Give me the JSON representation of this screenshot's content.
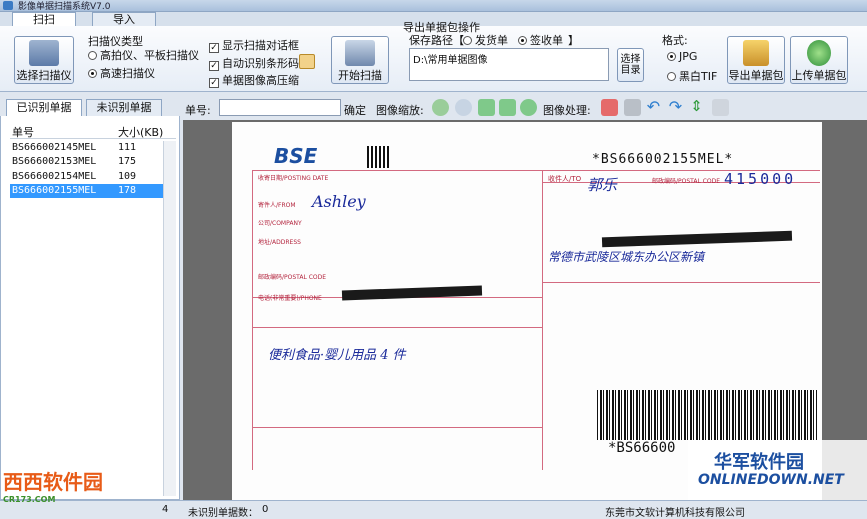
{
  "window": {
    "title": "影像单据扫描系统V7.0"
  },
  "tabs": [
    {
      "label": "扫扫"
    },
    {
      "label": "导入"
    }
  ],
  "scan": {
    "select_scanner": "选择扫描仪",
    "scanner_type_label": "扫描仪类型",
    "type_options": [
      "高拍仪、平板扫描仪",
      "高速扫描仪"
    ],
    "options": [
      "显示扫描对话框",
      "自动识别条形码",
      "单据图像高压缩"
    ],
    "start_scan": "开始扫描"
  },
  "export": {
    "group_label": "导出单据包操作",
    "save_path_label": "保存路径【",
    "radio_send": "发货单",
    "radio_sign": "签收单",
    "bracket_close": "】",
    "path_value": "D:\\常用单据图像",
    "choose_dir": "选择目录",
    "format_label": "格式:",
    "format_jpg": "JPG",
    "format_tif": "黑白TIF",
    "export_btn": "导出单据包",
    "upload_btn": "上传单据包"
  },
  "left": {
    "tab_recognized": "已识别单据",
    "tab_unrecognized": "未识别单据",
    "col_no": "单号",
    "col_size": "大小(KB)",
    "rows": [
      {
        "no": "BS666002145MEL",
        "size": "111"
      },
      {
        "no": "BS666002153MEL",
        "size": "175"
      },
      {
        "no": "BS666002154MEL",
        "size": "109"
      },
      {
        "no": "BS666002155MEL",
        "size": "178"
      }
    ]
  },
  "toolbar": {
    "order_label": "单号:",
    "order_value": "",
    "confirm": "确定",
    "zoom_label": "图像缩放:",
    "process_label": "图像处理:"
  },
  "doc": {
    "brand": "BSE",
    "barcode_top": "*BS666002155MEL*",
    "barcode_bottom": "*BS66600",
    "date_label": "收寄日期/POSTING DATE",
    "sender_label": "寄件人/FROM",
    "sender_name": "Ashley",
    "company_label": "公司/COMPANY",
    "address_label": "地址/ADDRESS",
    "postcode_label": "邮政编码/POSTAL CODE",
    "phone_label": "电话(非常重要)/PHONE",
    "recipient_label": "收件人/TO",
    "recipient_name": "郭乐",
    "postcode_right": "邮政编码/POSTAL CODE",
    "postcode_digits": "415000",
    "address_hand": "常德市武陵区城东办公区新镇",
    "contents_hand": "便利食品·婴儿用品 4 件"
  },
  "status": {
    "count_value": "4",
    "unrecognized_label": "未识别单据数：",
    "unrecognized_value": "0",
    "company": "东莞市文软计算机科技有限公司"
  },
  "watermarks": {
    "left": "西西软件园",
    "left_sub": "CR173.COM",
    "right": "华军软件园",
    "right_sub": "ONLINEDOWN.NET"
  }
}
